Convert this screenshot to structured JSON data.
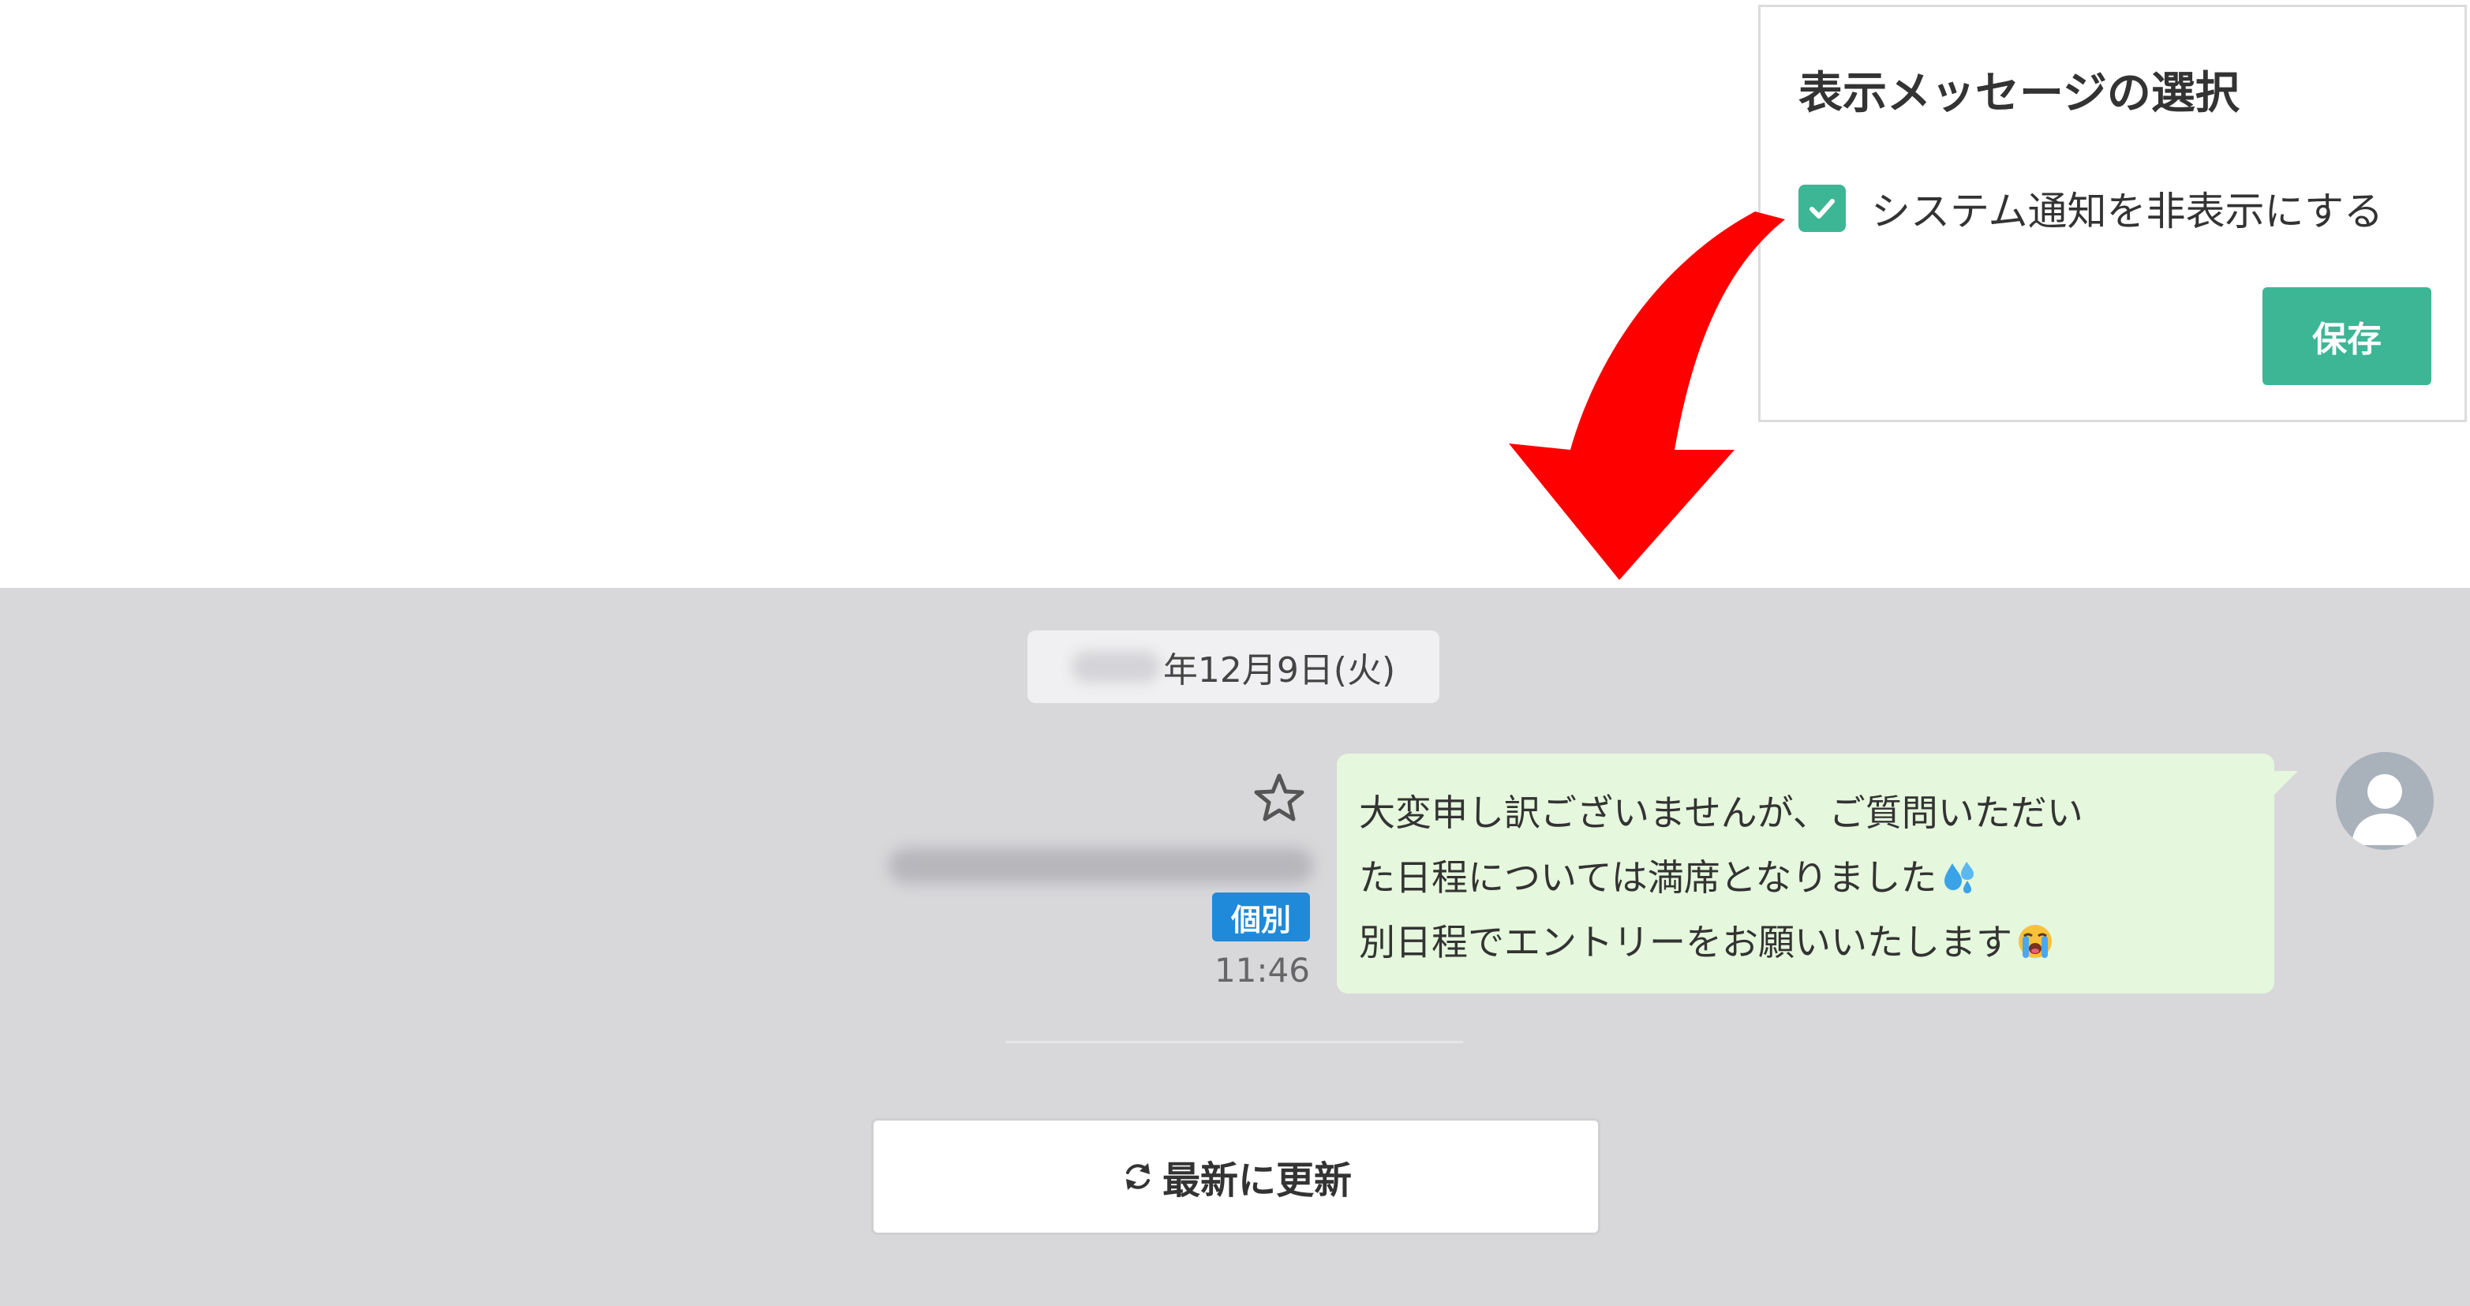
{
  "popup": {
    "title": "表示メッセージの選択",
    "checkbox_label": "システム通知を非表示にする",
    "checkbox_checked": true,
    "save_label": "保存",
    "accent_color": "#3db696"
  },
  "annotation": {
    "arrow_color": "#ff0000"
  },
  "chat": {
    "date_label": "年12月9日(火)",
    "message": {
      "lines": [
        "大変申し訳ございませんが、ご質問いただい",
        "た日程については満席となりました",
        "別日程でエントリーをお願いいたします"
      ],
      "line2_emoji": "sweat-droplets-emoji",
      "line3_emoji": "loudly-crying-face-emoji",
      "badge": "個別",
      "time": "11:46",
      "starred": false
    },
    "refresh_label": "最新に更新",
    "bubble_color": "#e5f7dc",
    "badge_color": "#1f8ad9"
  }
}
